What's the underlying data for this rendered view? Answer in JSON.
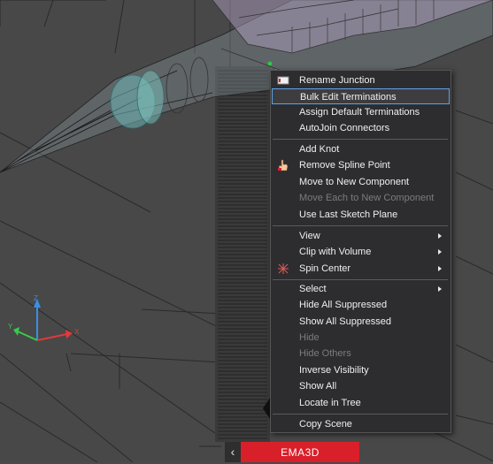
{
  "colors": {
    "menu_bg": "#2d2d30",
    "menu_text": "#f0f0f0",
    "menu_disabled": "#7c7c7c",
    "highlight_border": "#5fa3e6",
    "brand": "#d9202a",
    "viewport_bg": "#4a4a4a"
  },
  "menu": {
    "items": [
      {
        "label": "Rename Junction",
        "icon": "junction-label-icon"
      },
      {
        "label": "Bulk Edit Terminations",
        "highlighted": true
      },
      {
        "label": "Assign Default Terminations"
      },
      {
        "label": "AutoJoin Connectors"
      },
      {
        "label": "Add Knot"
      },
      {
        "label": "Remove Spline Point",
        "icon": "hand-pointer-icon"
      },
      {
        "label": "Move to New Component"
      },
      {
        "label": "Move Each to New Component",
        "disabled": true
      },
      {
        "label": "Use Last Sketch Plane"
      },
      {
        "label": "View",
        "submenu": true
      },
      {
        "label": "Clip with Volume",
        "submenu": true
      },
      {
        "label": "Spin Center",
        "submenu": true,
        "icon": "spin-center-icon"
      },
      {
        "label": "Select",
        "submenu": true
      },
      {
        "label": "Hide All Suppressed"
      },
      {
        "label": "Show All Suppressed"
      },
      {
        "label": "Hide",
        "disabled": true
      },
      {
        "label": "Hide Others",
        "disabled": true
      },
      {
        "label": "Inverse Visibility"
      },
      {
        "label": "Show All"
      },
      {
        "label": "Locate in Tree"
      },
      {
        "label": "Copy Scene"
      }
    ]
  },
  "bottom_bar": {
    "back_label": "‹",
    "brand_label": "EMA3D"
  },
  "axis": {
    "x_label": "X",
    "y_label": "Y",
    "z_label": "Z"
  }
}
